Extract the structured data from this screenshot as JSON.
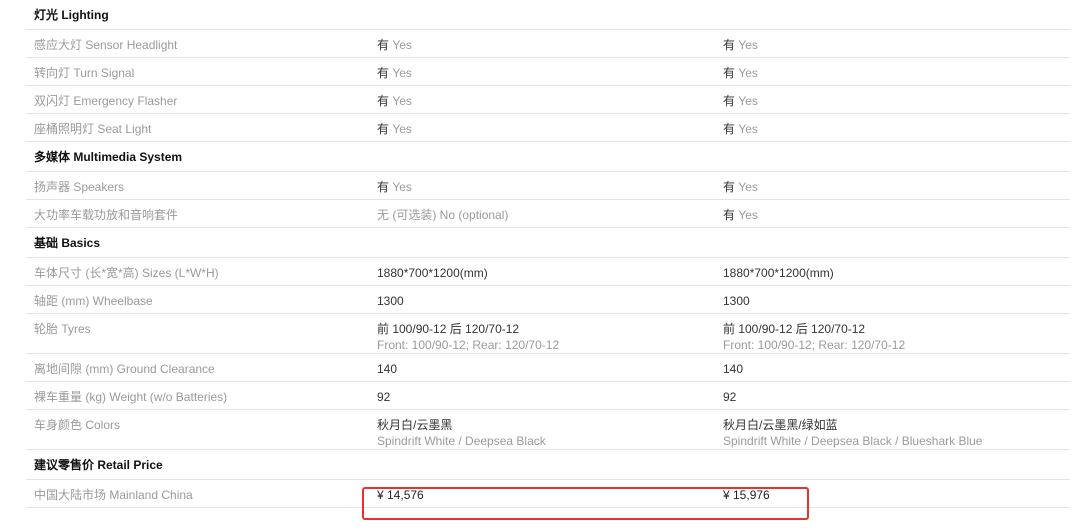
{
  "highlight_color": "#e8322a",
  "sections": [
    {
      "title": "灯光 Lighting",
      "rows": [
        {
          "label": "感应大灯 Sensor Headlight",
          "v1": "有",
          "v1_en": "Yes",
          "v2": "有",
          "v2_en": "Yes"
        },
        {
          "label": "转向灯 Turn Signal",
          "v1": "有",
          "v1_en": "Yes",
          "v2": "有",
          "v2_en": "Yes"
        },
        {
          "label": "双闪灯 Emergency Flasher",
          "v1": "有",
          "v1_en": "Yes",
          "v2": "有",
          "v2_en": "Yes"
        },
        {
          "label": "座桶照明灯 Seat Light",
          "v1": "有",
          "v1_en": "Yes",
          "v2": "有",
          "v2_en": "Yes"
        }
      ]
    },
    {
      "title": "多媒体 Multimedia System",
      "rows": [
        {
          "label": "扬声器 Speakers",
          "v1": "有",
          "v1_en": "Yes",
          "v2": "有",
          "v2_en": "Yes"
        },
        {
          "label": "大功率车载功放和音响套件",
          "v1": "无 (可选装)",
          "v1_en": "No (optional)",
          "v2": "有",
          "v2_en": "Yes"
        }
      ]
    },
    {
      "title": "基础 Basics",
      "rows": [
        {
          "label": "车体尺寸 (长*宽*高) Sizes (L*W*H)",
          "v1": "1880*700*1200(mm)",
          "v2": "1880*700*1200(mm)"
        },
        {
          "label": "轴距 (mm) Wheelbase",
          "v1": "1300",
          "v2": "1300"
        },
        {
          "label": "轮胎 Tyres",
          "v1": "前 100/90-12 后 120/70-12",
          "v1_sub": "Front: 100/90-12; Rear: 120/70-12",
          "v2": "前 100/90-12 后 120/70-12",
          "v2_sub": "Front: 100/90-12; Rear: 120/70-12"
        },
        {
          "label": "离地间隙 (mm) Ground Clearance",
          "v1": "140",
          "v2": "140"
        },
        {
          "label": "裸车重量 (kg) Weight (w/o Batteries)",
          "v1": "92",
          "v2": "92"
        },
        {
          "label": "车身颜色 Colors",
          "v1": "秋月白/云墨黑",
          "v1_sub": "Spindrift White / Deepsea Black",
          "v2": "秋月白/云墨黑/绿如蓝",
          "v2_sub": "Spindrift White / Deepsea Black / Blueshark Blue"
        }
      ]
    },
    {
      "title": "建议零售价 Retail Price",
      "rows": [
        {
          "label": "中国大陆市场 Mainland China",
          "v1": "¥ 14,576",
          "v2": "¥ 15,976"
        }
      ]
    }
  ]
}
